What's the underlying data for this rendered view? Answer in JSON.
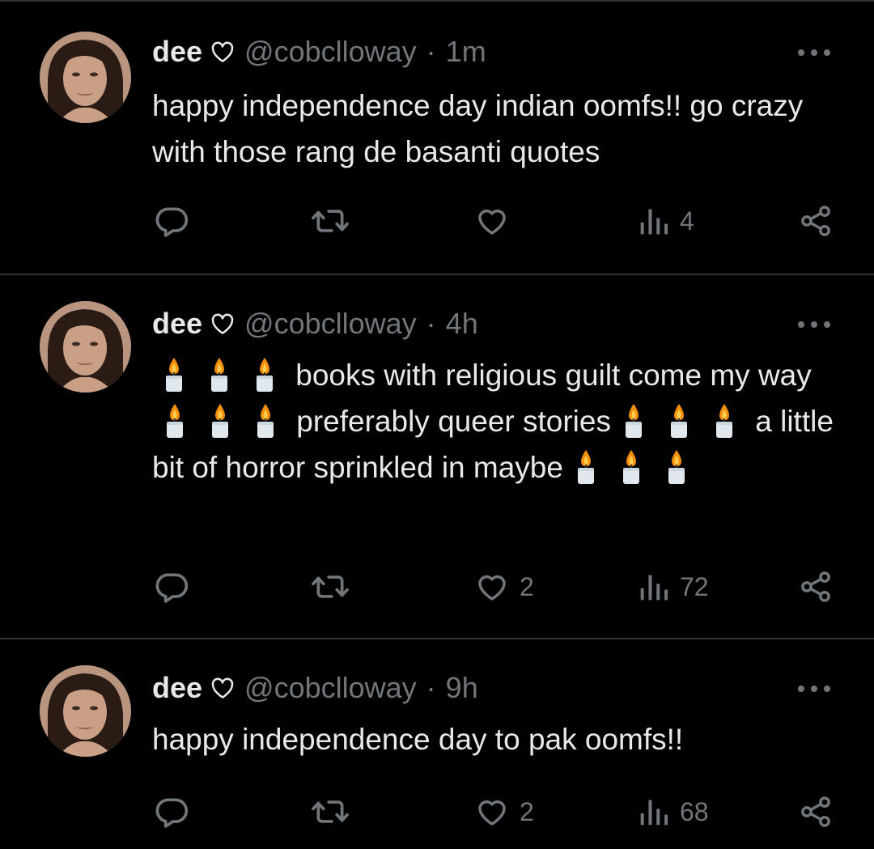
{
  "colors": {
    "background": "#000000",
    "text_primary": "#e7e9ea",
    "text_secondary": "#71767b",
    "divider": "#2f3336"
  },
  "tweets": [
    {
      "display_name": "dee",
      "name_badge_icon": "heart-outline-icon",
      "handle": "@cobclloway",
      "separator": "·",
      "time": "1m",
      "segments": [
        {
          "t": "text",
          "v": "happy independence day indian oomfs!! go crazy with those rang de basanti quotes"
        }
      ],
      "actions": {
        "reply": "",
        "retweet": "",
        "like": "",
        "views": "4"
      }
    },
    {
      "display_name": "dee",
      "name_badge_icon": "heart-outline-icon",
      "handle": "@cobclloway",
      "separator": "·",
      "time": "4h",
      "segments": [
        {
          "t": "candle"
        },
        {
          "t": "candle"
        },
        {
          "t": "candle"
        },
        {
          "t": "text",
          "v": " books with religious guilt come my way"
        },
        {
          "t": "candle"
        },
        {
          "t": "candle"
        },
        {
          "t": "candle"
        },
        {
          "t": "text",
          "v": " preferably queer stories"
        },
        {
          "t": "candle"
        },
        {
          "t": "candle"
        },
        {
          "t": "candle"
        },
        {
          "t": "text",
          "v": " a little bit of horror sprinkled in maybe"
        },
        {
          "t": "candle"
        },
        {
          "t": "candle"
        },
        {
          "t": "candle"
        }
      ],
      "actions": {
        "reply": "",
        "retweet": "",
        "like": "2",
        "views": "72"
      }
    },
    {
      "display_name": "dee",
      "name_badge_icon": "heart-outline-icon",
      "handle": "@cobclloway",
      "separator": "·",
      "time": "9h",
      "segments": [
        {
          "t": "text",
          "v": "happy independence day to pak oomfs!!"
        }
      ],
      "actions": {
        "reply": "",
        "retweet": "",
        "like": "2",
        "views": "68"
      }
    }
  ],
  "icons": {
    "reply": "reply-icon",
    "retweet": "retweet-icon",
    "like": "heart-icon",
    "views": "views-icon",
    "share": "share-icon",
    "more": "more-icon",
    "candle": "candle-emoji"
  }
}
